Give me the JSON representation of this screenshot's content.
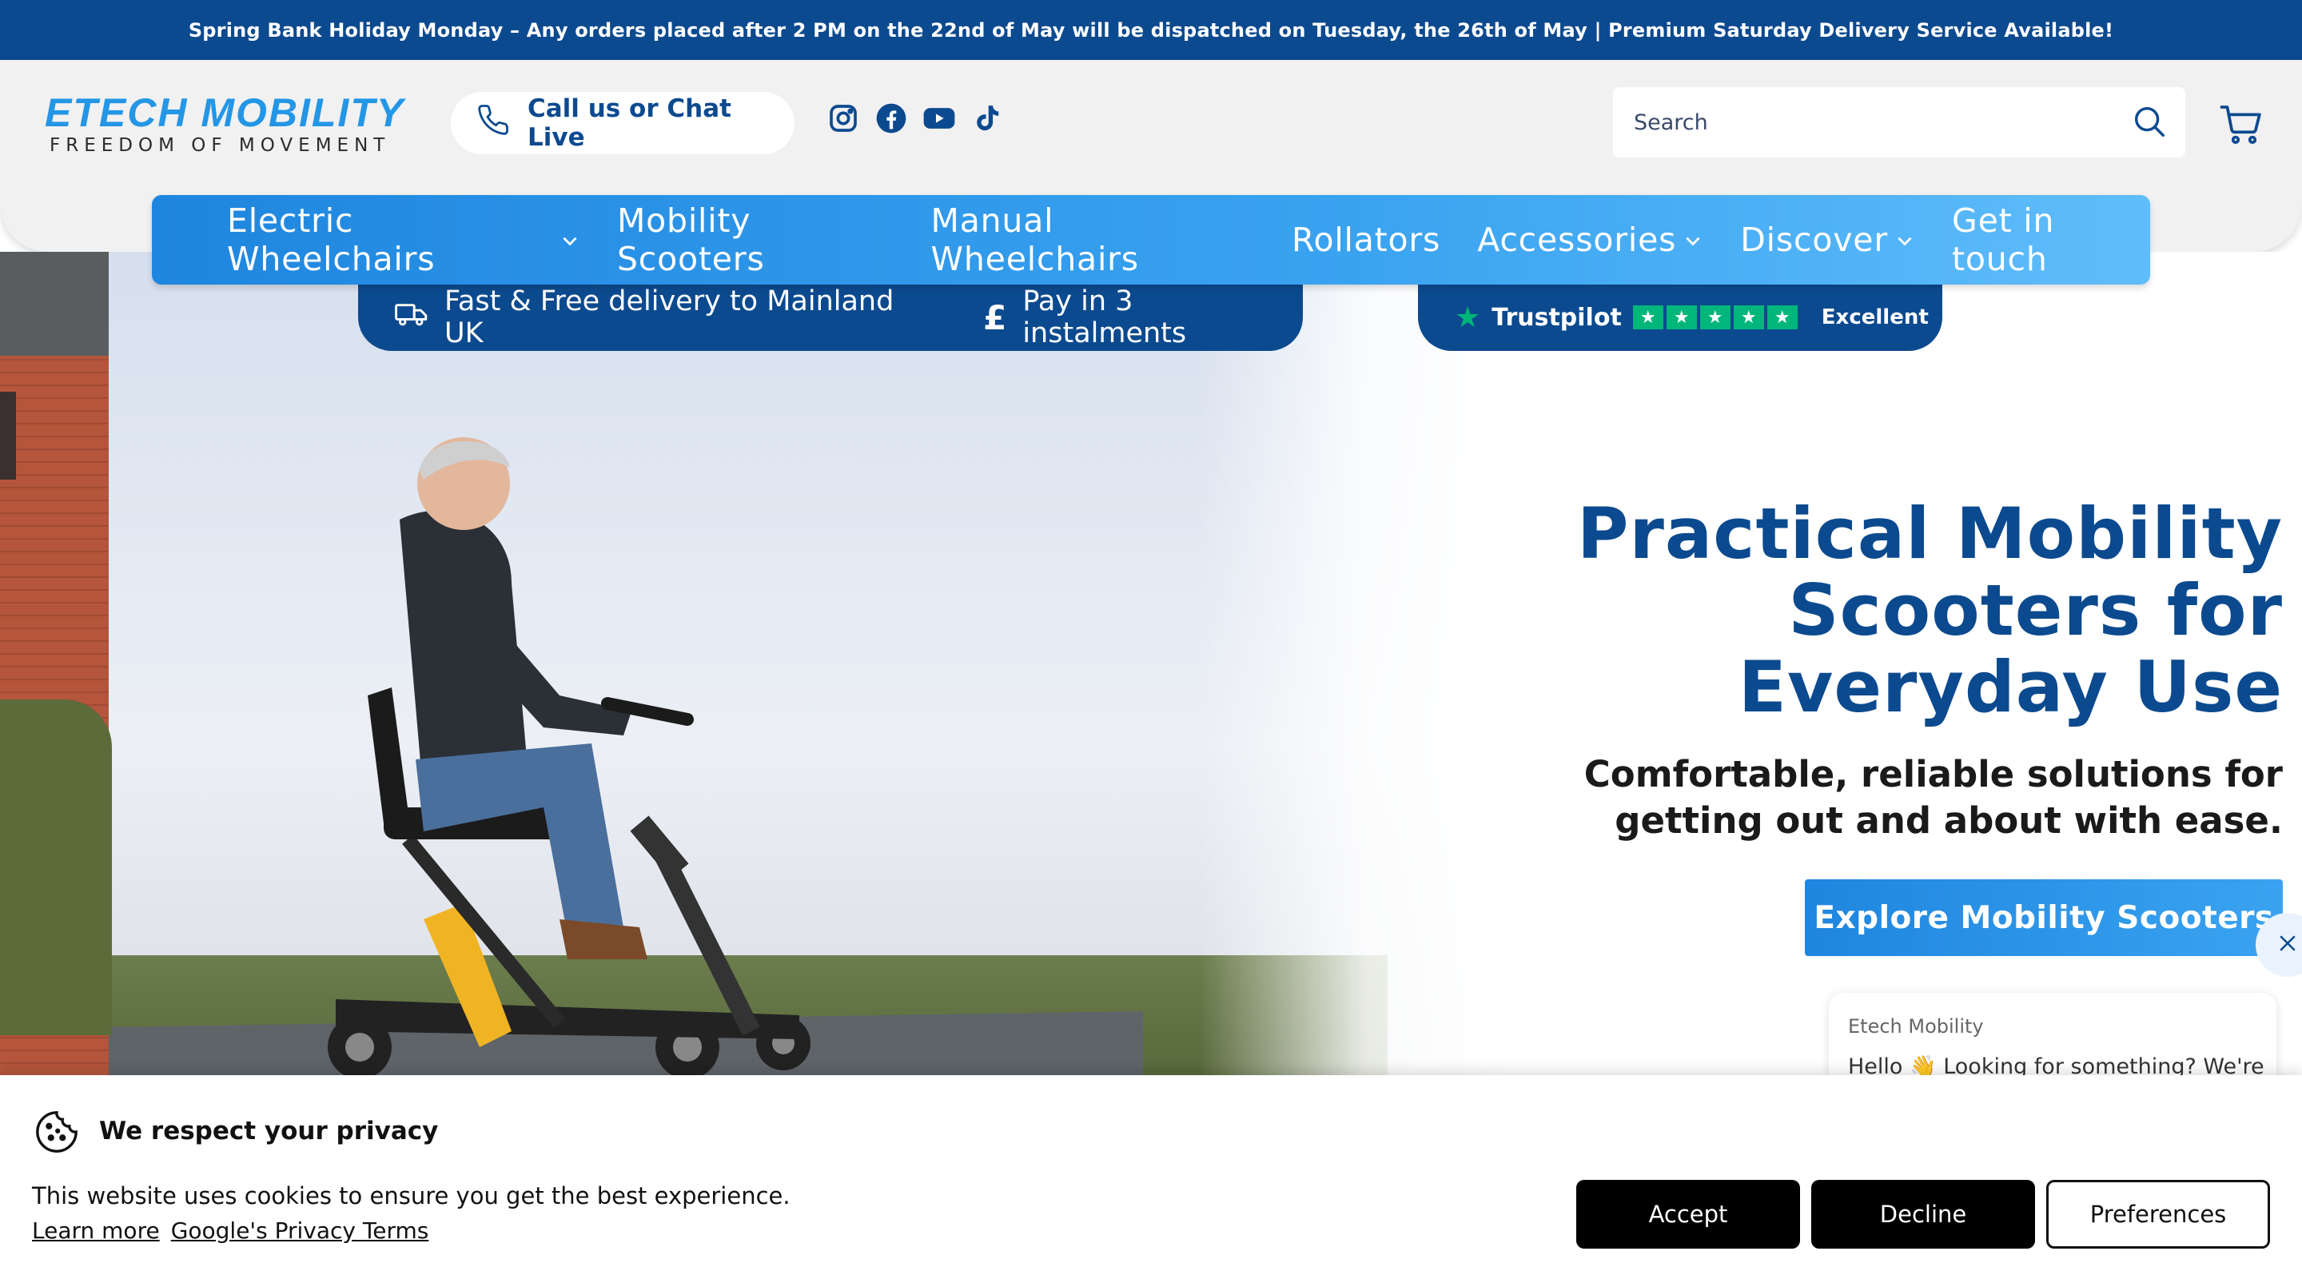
{
  "announcement": "Spring Bank Holiday Monday – Any orders placed after 2 PM on the 22nd of May will be dispatched on Tuesday, the 26th of May | Premium Saturday Delivery Service Available!",
  "logo": {
    "main": "ETECH MOBILITY",
    "sub": "FREEDOM OF MOVEMENT"
  },
  "header": {
    "call_label": "Call us or Chat Live",
    "social": [
      "instagram-icon",
      "facebook-icon",
      "youtube-icon",
      "tiktok-icon"
    ],
    "search_placeholder": "Search"
  },
  "nav": {
    "items": [
      {
        "label": "Electric Wheelchairs",
        "dropdown": true
      },
      {
        "label": "Mobility Scooters",
        "dropdown": false
      },
      {
        "label": "Manual Wheelchairs",
        "dropdown": false
      },
      {
        "label": "Rollators",
        "dropdown": false
      },
      {
        "label": "Accessories",
        "dropdown": true
      },
      {
        "label": "Discover",
        "dropdown": true
      },
      {
        "label": "Get in touch",
        "dropdown": false
      }
    ]
  },
  "usp": {
    "delivery": "Fast & Free delivery to Mainland UK",
    "instalments": "Pay in 3 instalments",
    "trustpilot": "Trustpilot",
    "rating_text": "Excellent",
    "stars": 5
  },
  "hero": {
    "title": "Practical Mobility Scooters for Everyday Use",
    "subtitle": "Comfortable, reliable solutions for getting out and about with ease.",
    "cta": "Explore Mobility Scooters"
  },
  "chat": {
    "name": "Etech Mobility",
    "message": "Hello 👋 Looking for something? We're"
  },
  "cookie": {
    "title": "We respect your privacy",
    "text": "This website uses cookies to ensure you get the best experience.",
    "link_learn": "Learn more",
    "link_google": "Google's Privacy Terms",
    "accept": "Accept",
    "decline": "Decline",
    "preferences": "Preferences"
  },
  "colors": {
    "brand_dark": "#0c4a8f",
    "brand_light": "#2496e6",
    "trustpilot_green": "#00b67a"
  }
}
